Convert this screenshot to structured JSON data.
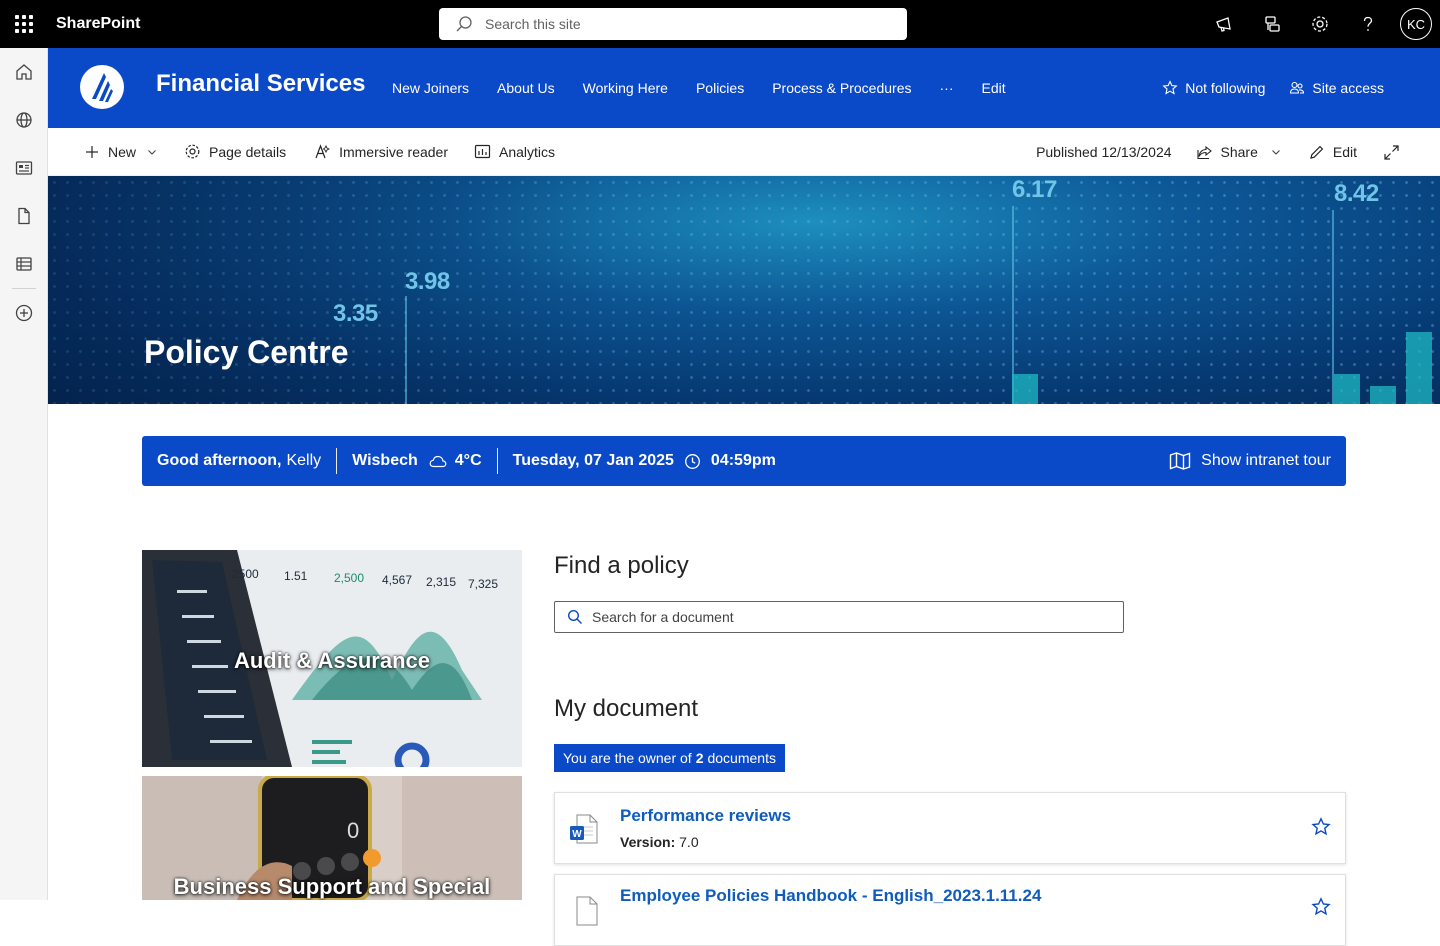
{
  "suite": {
    "brand": "SharePoint",
    "search_placeholder": "Search this site",
    "avatar_initials": "KC"
  },
  "site": {
    "title": "Financial Services",
    "nav": [
      "New Joiners",
      "About Us",
      "Working Here",
      "Policies",
      "Process & Procedures",
      "···",
      "Edit"
    ],
    "not_following": "Not following",
    "site_access": "Site access"
  },
  "commandbar": {
    "new": "New",
    "page_details": "Page details",
    "immersive_reader": "Immersive reader",
    "analytics": "Analytics",
    "published": "Published 12/13/2024",
    "share": "Share",
    "edit": "Edit"
  },
  "hero": {
    "title": "Policy Centre",
    "numbers": [
      "6.17",
      "8.42",
      "3.98",
      "3.35"
    ]
  },
  "greeting": {
    "salutation": "Good afternoon,",
    "name": "Kelly",
    "location": "Wisbech",
    "temperature": "4°C",
    "date": "Tuesday, 07 Jan 2025",
    "time": "04:59pm",
    "tour": "Show intranet tour"
  },
  "tiles": {
    "tile1": "Audit & Assurance",
    "tile2": "Business Support and Special"
  },
  "find_policy": {
    "heading": "Find a policy",
    "search_placeholder": "Search for a document"
  },
  "my_document": {
    "heading": "My document",
    "owner_prefix": "You are the owner of",
    "owner_count": "2",
    "owner_suffix": "documents",
    "version_label": "Version:",
    "docs": [
      {
        "title": "Performance reviews",
        "version": "7.0"
      },
      {
        "title": "Employee Policies Handbook - English_2023.1.11.24",
        "version": ""
      }
    ]
  },
  "colors": {
    "brand_blue": "#0a49c8",
    "suite_bar": "#000000",
    "link_blue": "#0f5cbd"
  }
}
